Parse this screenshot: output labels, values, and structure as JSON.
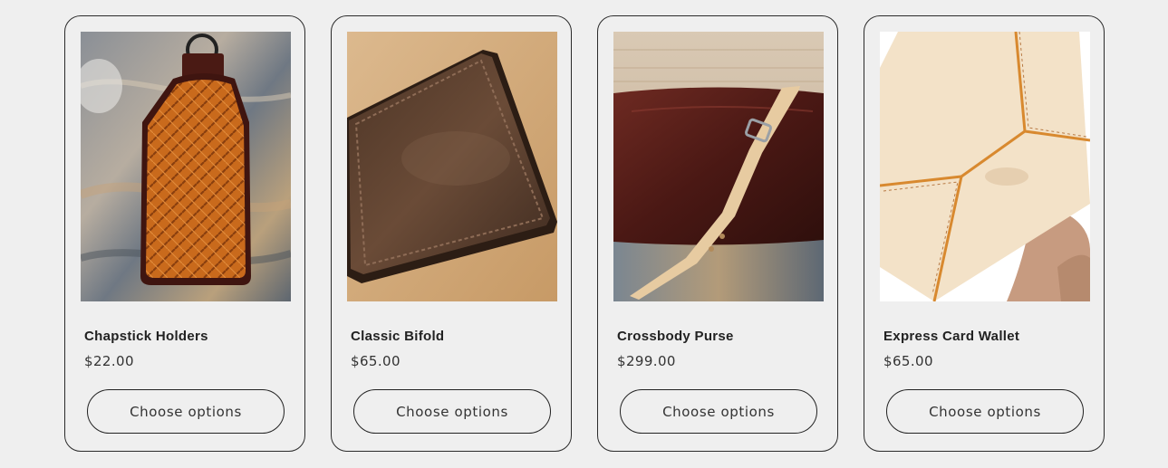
{
  "products": [
    {
      "title": "Chapstick Holders",
      "price": "$22.00",
      "button_label": "Choose options",
      "image_name": "chapstick-holder-image"
    },
    {
      "title": "Classic Bifold",
      "price": "$65.00",
      "button_label": "Choose options",
      "image_name": "classic-bifold-image"
    },
    {
      "title": "Crossbody Purse",
      "price": "$299.00",
      "button_label": "Choose options",
      "image_name": "crossbody-purse-image"
    },
    {
      "title": "Express Card Wallet",
      "price": "$65.00",
      "button_label": "Choose options",
      "image_name": "express-card-wallet-image"
    }
  ],
  "colors": {
    "page_background": "#efefef",
    "card_border": "#2b2b2b",
    "text": "#222222"
  }
}
